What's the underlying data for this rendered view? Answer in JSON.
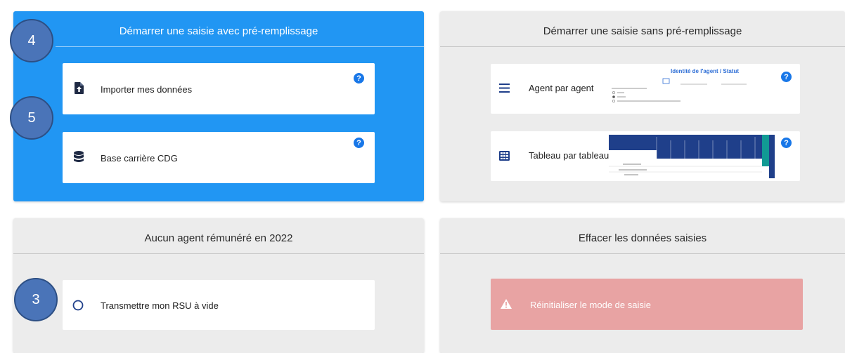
{
  "panels": {
    "prefill": {
      "title": "Démarrer une saisie avec pré-remplissage",
      "cards": [
        {
          "label": "Importer mes données",
          "icon": "file-upload-icon",
          "help": "?"
        },
        {
          "label": "Base carrière CDG",
          "icon": "database-icon",
          "help": "?"
        }
      ]
    },
    "noprefill": {
      "title": "Démarrer une saisie sans pré-remplissage",
      "cards": [
        {
          "label": "Agent par agent",
          "icon": "list-icon",
          "help": "?"
        },
        {
          "label": "Tableau par tableau",
          "icon": "grid-icon",
          "help": "?"
        }
      ],
      "thumb_agent": {
        "title": "Identité de l'agent / Statut"
      }
    },
    "empty": {
      "title": "Aucun agent rémunéré en 2022",
      "cards": [
        {
          "label": "Transmettre mon RSU à vide",
          "icon": "radio-circle-icon"
        }
      ]
    },
    "reset": {
      "title": "Effacer les données saisies",
      "cards": [
        {
          "label": "Réinitialiser le mode de saisie",
          "icon": "warning-icon"
        }
      ]
    }
  },
  "badges": [
    "4",
    "5",
    "3"
  ],
  "colors": {
    "accent": "#2196f3",
    "warning": "#e8a3a3",
    "help": "#1877e8",
    "badge": "#4a74b8"
  }
}
